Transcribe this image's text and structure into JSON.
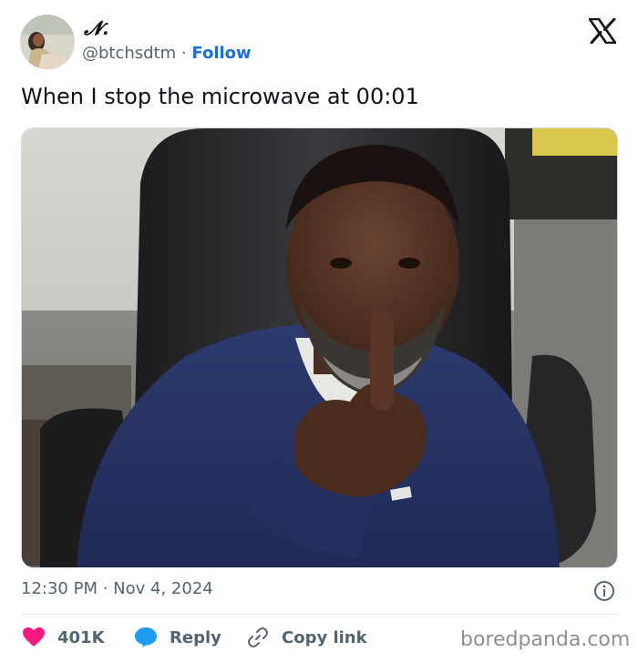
{
  "tweet": {
    "display_name": "𝓝.",
    "handle": "@btchsdtm",
    "separator": "·",
    "follow_label": "Follow",
    "text": "When I stop the microwave at 00:01",
    "time": "12:30 PM",
    "date": "Nov 4, 2024",
    "likes": "401K",
    "reply_label": "Reply",
    "copy_link_label": "Copy link"
  },
  "icons": {
    "logo": "x-logo-icon",
    "info": "info-icon",
    "like": "heart-icon",
    "reply": "reply-bubble-icon",
    "copy": "link-icon"
  },
  "colors": {
    "follow": "#1d6fd8",
    "heart": "#f91880",
    "reply": "#1d9bf0",
    "muted": "#536471"
  },
  "watermark": "boredpanda.com"
}
